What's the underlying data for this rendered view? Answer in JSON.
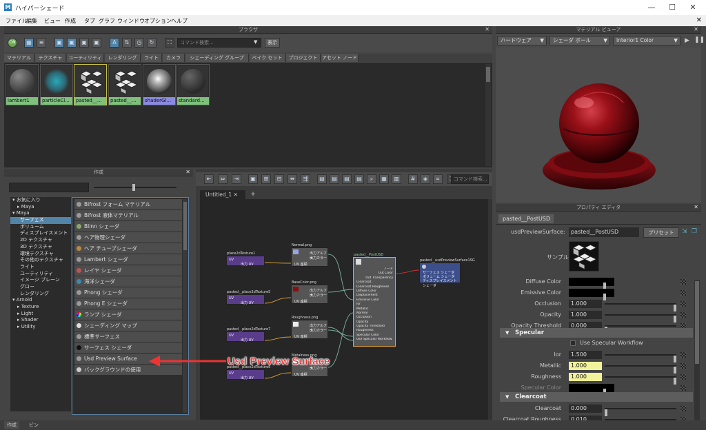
{
  "window": {
    "title": "ハイパーシェード",
    "app_icon": "M"
  },
  "menu": [
    "ファイル",
    "編集",
    "ビュー",
    "作成",
    "タブ",
    "グラフ",
    "ウィンドウ",
    "オプション",
    "ヘルプ"
  ],
  "browser": {
    "title": "ブラウザ",
    "search_placeholder": "コマンド検索...",
    "show_button": "表示",
    "tabs": [
      "マテリアル",
      "テクスチャ",
      "ユーティリティ",
      "レンダリング",
      "ライト",
      "カメラ",
      "シェーディング グループ",
      "ベイク セット",
      "プロジェクト",
      "アセット ノード"
    ],
    "swatches": [
      "lambert1",
      "particleCl...",
      "pasted__...",
      "pasted__...",
      "shaderGl...",
      "standard..."
    ]
  },
  "create": {
    "title": "作成",
    "categories": [
      "お気に入り",
      "Maya",
      "Maya",
      "サーフェス",
      "ボリューム",
      "ディスプレイスメント",
      "2D テクスチャ",
      "3D テクスチャ",
      "環境テクスチャ",
      "その他のテクスチャ",
      "ライト",
      "ユーティリティ",
      "イメージ プレーン",
      "グロー",
      "レンダリング",
      "Arnold",
      "Texture",
      "Light",
      "Shader",
      "Utility"
    ],
    "nodes": [
      "Bifrost フォーム マテリアル",
      "Bifrost 液体マテリアル",
      "Blinn シェーダ",
      "ヘア物理シェーダ",
      "ヘア チューブシェーダ",
      "Lambert シェーダ",
      "レイヤ シェーダ",
      "海洋シェーダ",
      "Phong シェーダ",
      "Phong E シェーダ",
      "ランプ シェーダ",
      "シェーディング マップ",
      "標準サーフェス",
      "サーフェス シェーダ",
      "Usd Preview Surface",
      "バックグラウンドの使用"
    ]
  },
  "graph": {
    "search_placeholder": "コマンド検索...",
    "tabs": [
      "Untitled_1",
      "+"
    ],
    "nodes": [
      {
        "title": "place2dTexture1",
        "rows": [
          "UV",
          "出力 UV"
        ]
      },
      {
        "title": "pasted__place2dTexture5",
        "rows": [
          "UV",
          "出力 UV"
        ]
      },
      {
        "title": "pasted__place2dTexture7",
        "rows": [
          "UV",
          "出力 UV"
        ]
      },
      {
        "title": "pasted__place2dTexture6",
        "rows": [
          "UV",
          "出力 UV"
        ]
      },
      {
        "title": "Normal.png",
        "rows": [
          "出力アルファ",
          "出力カラー",
          "UV 座標"
        ]
      },
      {
        "title": "BaseColor.png",
        "rows": [
          "出力アルファ",
          "出力カラー",
          "UV 座標"
        ]
      },
      {
        "title": "Roughness.png",
        "rows": [
          "出力アルファ",
          "出力カラー",
          "UV 座標"
        ]
      },
      {
        "title": "Metalness.png",
        "rows": [
          "出力アルファ",
          "出力カラー",
          "UV 座標"
        ]
      },
      {
        "title": "pasted__PostUSD",
        "rows": [
          "ノード",
          "Out Color",
          "Out Transparency",
          "Clearcoat",
          "Clearcoat Roughness",
          "Diffuse Color",
          "Displacement",
          "Emissive Color",
          "Ior",
          "Metallic",
          "Normal",
          "Occlusion",
          "Opacity",
          "Opacity Threshold",
          "Roughness",
          "Specular Color",
          "Use Specular Workflow"
        ]
      },
      {
        "title": "pasted__usdPreviewSurface1SG",
        "rows": [
          "サーフェス シェーダ",
          "ボリューム シェーダ",
          "ディスプレイスメント シェーダ"
        ]
      }
    ]
  },
  "material_viewer": {
    "title": "マテリアル ビューア",
    "renderer": "ハードウェア",
    "shape": "シェーダ ボール",
    "env": "Interior1 Color"
  },
  "property_editor": {
    "title": "プロパティ エディタ",
    "tab": "pasted__PostUSD",
    "type_label": "usdPreviewSurface:",
    "name": "pasted__PostUSD",
    "preset_button": "プリセット",
    "sample_label": "サンプル",
    "attrs1": [
      {
        "label": "Diffuse Color",
        "value": ""
      },
      {
        "label": "Emissive Color",
        "value": ""
      },
      {
        "label": "Occlusion",
        "value": "1.000"
      },
      {
        "label": "Opacity",
        "value": "1.000"
      },
      {
        "label": "Opacity Threshold",
        "value": "0.000"
      }
    ],
    "specular_section": "Specular",
    "use_specular": "Use Specular Workflow",
    "attrs2": [
      {
        "label": "Ior",
        "value": "1.500"
      },
      {
        "label": "Metallic",
        "value": "1.000"
      },
      {
        "label": "Roughness",
        "value": "1.000"
      },
      {
        "label": "Specular Color",
        "value": ""
      }
    ],
    "clearcoat_section": "Clearcoat",
    "attrs3": [
      {
        "label": "Clearcoat",
        "value": "0.000"
      },
      {
        "label": "Clearcoat Roughness",
        "value": "0.010"
      }
    ]
  },
  "annotation": "Usd Preview Surface",
  "bottom_tabs": [
    "作成",
    "ビン"
  ],
  "colors": {
    "accent": "#5284a8",
    "swatch_label": "#7ec07c",
    "annotation": "#e33333",
    "shader_ball": "#8a0c14"
  }
}
